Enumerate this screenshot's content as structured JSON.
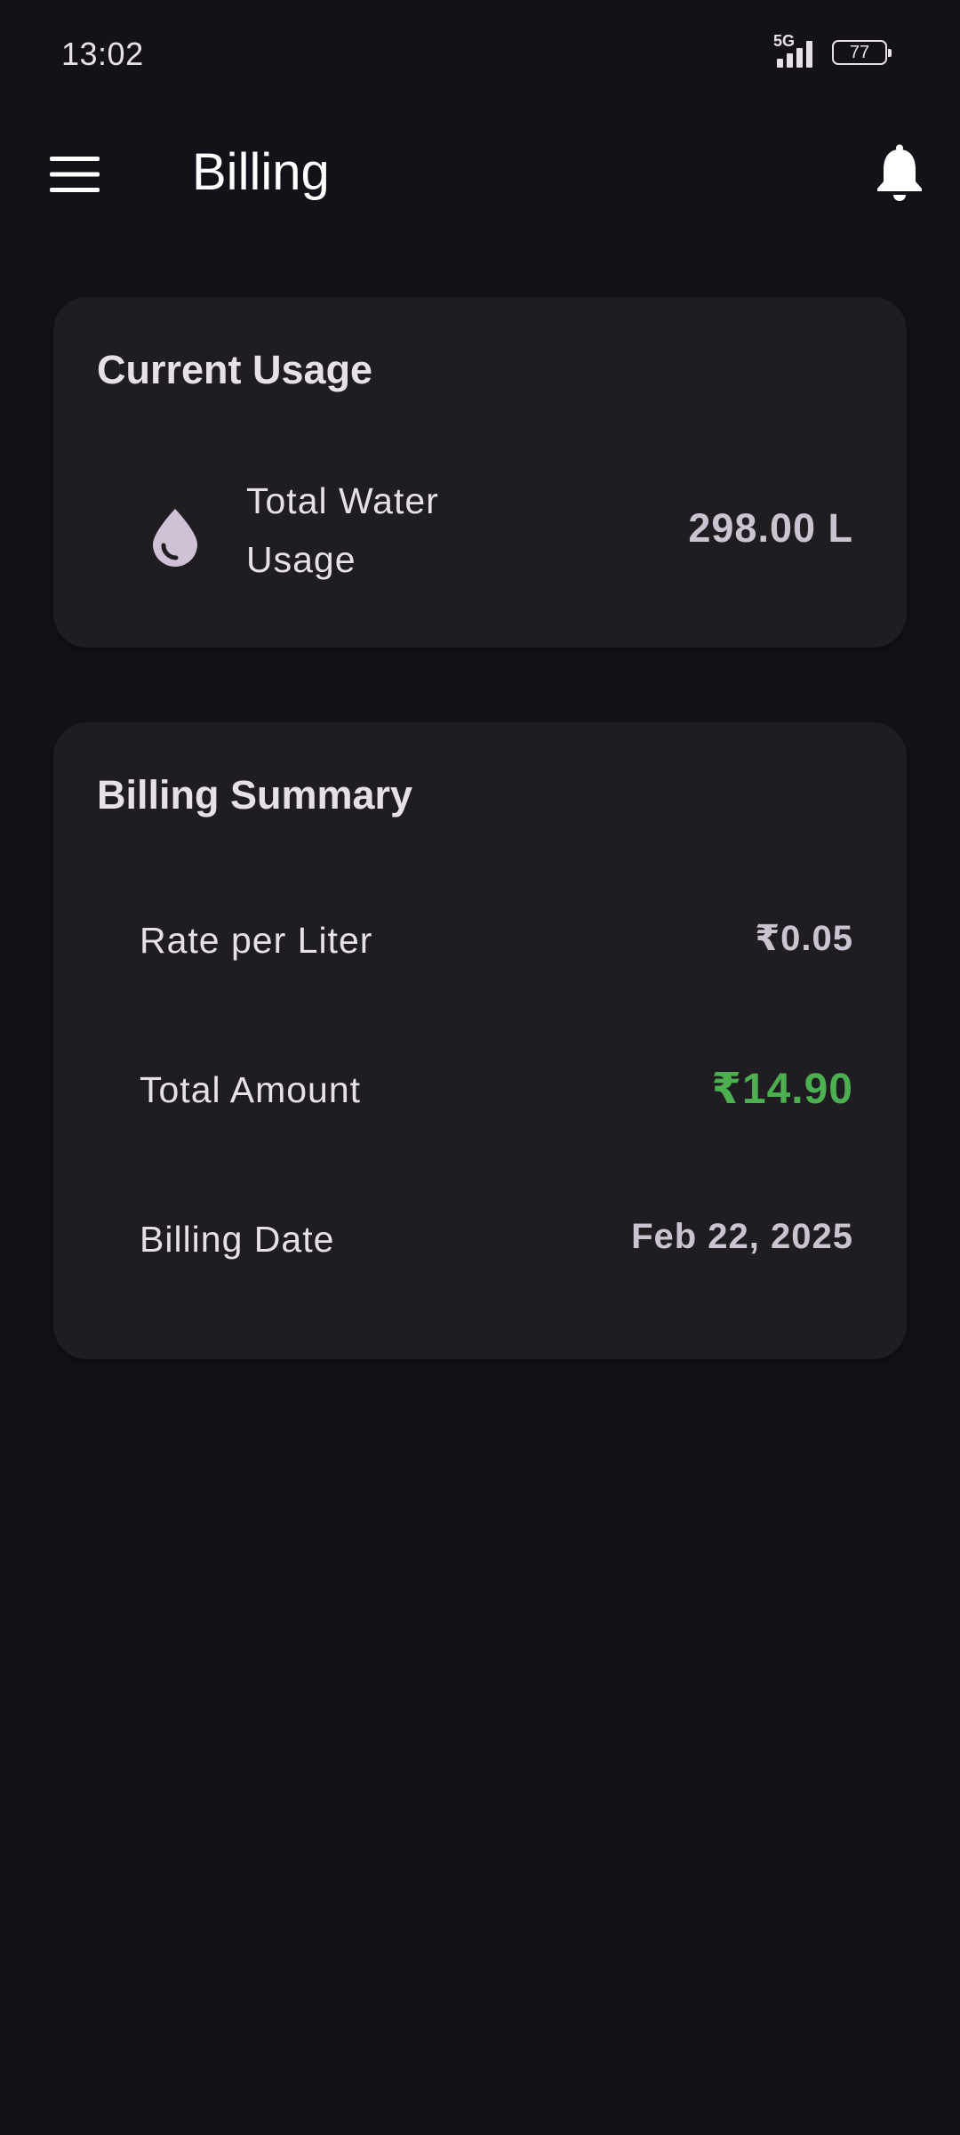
{
  "status_bar": {
    "time": "13:02",
    "network": "5G",
    "battery_level": "77",
    "icons": [
      "signal-5g-icon",
      "battery-icon"
    ]
  },
  "app_bar": {
    "title": "Billing",
    "menu_icon": "hamburger-menu-icon",
    "notification_icon": "bell-icon"
  },
  "current_usage": {
    "title": "Current Usage",
    "icon": "water-drop-icon",
    "label": "Total Water Usage",
    "value": "298.00 L"
  },
  "billing_summary": {
    "title": "Billing Summary",
    "rows": [
      {
        "label": "Rate per Liter",
        "value": "₹0.05"
      },
      {
        "label": "Total Amount",
        "value": "₹14.90"
      },
      {
        "label": "Billing Date",
        "value": "Feb 22, 2025"
      }
    ]
  },
  "colors": {
    "background": "#141218",
    "card": "#1F1D22",
    "accent_amount": "#4CAF50",
    "text_primary": "#E6E0E9",
    "text_value": "#CAC4D0"
  }
}
